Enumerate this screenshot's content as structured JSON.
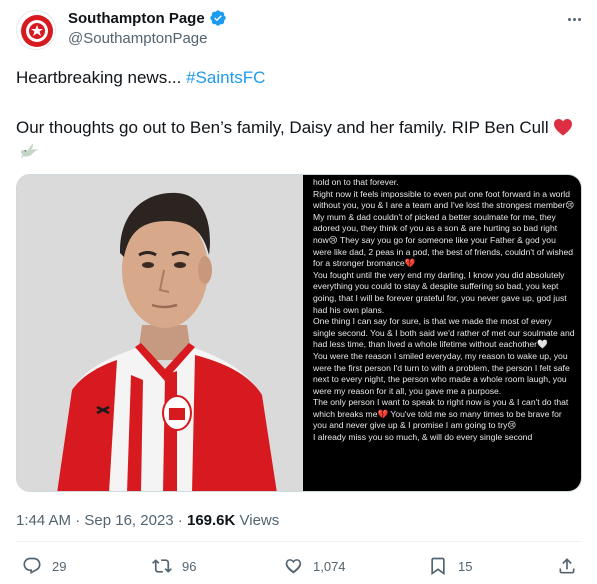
{
  "account": {
    "display_name": "Southampton Page",
    "handle": "@SouthamptonPage",
    "verified": true
  },
  "tweet": {
    "intro_text": "Heartbreaking news... ",
    "hashtag": "#SaintsFC",
    "message": "Our thoughts go out to Ben’s family, Daisy and her family. RIP Ben Cull",
    "emojis": [
      "red-heart",
      "dove"
    ]
  },
  "letter_lines": [
    "hold on to that forever.",
    "Right now it feels impossible to even put one foot forward in a world without you, you & I are a team and I've lost the strongest member😢",
    "My mum & dad couldn't of picked a better soulmate for me, they adored you, they think of you as a son & are hurting so bad right now😢 They say you go for someone like your Father & god you were like dad, 2 peas in a pod, the best of friends, couldn't of wished for a stronger bromance💔",
    "You fought until the very end my darling, I know you did absolutely everything you could to stay & despite suffering so bad, you kept going, that I will be forever grateful for, you never gave up, god just had his own plans.",
    "One thing I can say for sure, is that we made the most of every single second. You & I both said we'd rather of met our soulmate and had less time, than lived a whole lifetime without eachother🤍",
    "You were the reason I smiled everyday, my reason to wake up, you were the first person I'd turn to with a problem, the person I felt safe next to every night, the person who made a whole room laugh, you were my reason for it all, you gave me a purpose.",
    "The only person I want to speak to right now is you & I can't do that which breaks me💔 You've told me so many times to be brave for you and never give up & I promise I am going to try😢",
    "I already miss you so much, & will do every single second"
  ],
  "meta": {
    "time": "1:44 AM",
    "separator": " · ",
    "date": "Sep 16, 2023",
    "views_count": "169.6K",
    "views_label": " Views"
  },
  "actions": {
    "replies": "29",
    "reposts": "96",
    "likes": "1,074",
    "bookmarks": "15"
  },
  "colors": {
    "accent": "#1d9bf0",
    "text": "#0f1419",
    "muted": "#536471",
    "saints_red": "#d71920"
  },
  "icons": [
    "more-icon",
    "verified-badge-icon",
    "reply-icon",
    "repost-icon",
    "like-icon",
    "bookmark-icon",
    "share-icon"
  ]
}
